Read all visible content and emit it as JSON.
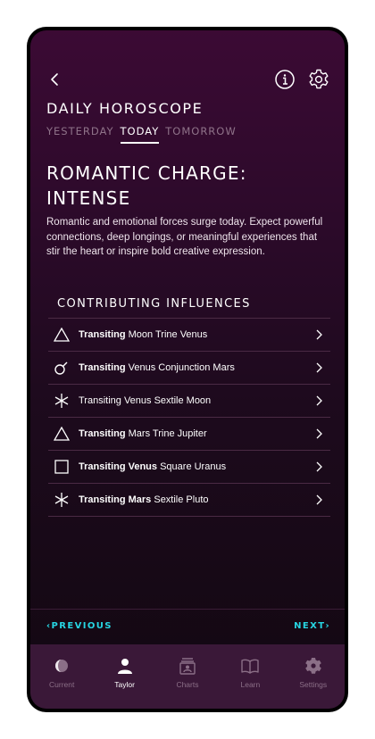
{
  "header": {
    "title": "DAILY HOROSCOPE"
  },
  "tabs": [
    {
      "label": "YESTERDAY"
    },
    {
      "label": "TODAY"
    },
    {
      "label": "TOMORROW"
    }
  ],
  "headline": "ROMANTIC CHARGE: INTENSE",
  "description": "Romantic and emotional forces surge today. Expect powerful connections, deep longings, or meaningful experiences that stir the heart or inspire bold creative expression.",
  "section_title": "CONTRIBUTING INFLUENCES",
  "influences": [
    {
      "bold": "Transiting",
      "text": " Moon Trine Venus",
      "icon": "trine-icon"
    },
    {
      "bold": "Transiting",
      "text": " Venus Conjunction Mars",
      "icon": "conjunction-icon"
    },
    {
      "bold": "",
      "text": "Transiting Venus Sextile Moon",
      "icon": "sextile-icon"
    },
    {
      "bold": "Transiting",
      "text": " Mars Trine Jupiter",
      "icon": "trine-icon"
    },
    {
      "bold": "Transiting Venus",
      "text": " Square Uranus",
      "icon": "square-icon"
    },
    {
      "bold": "Transiting Mars",
      "text": " Sextile Pluto",
      "icon": "sextile-icon"
    }
  ],
  "pager": {
    "prev": "PREVIOUS",
    "next": "NEXT"
  },
  "nav": [
    {
      "label": "Current",
      "icon": "moon-phase-icon"
    },
    {
      "label": "Taylor",
      "icon": "person-icon"
    },
    {
      "label": "Charts",
      "icon": "charts-icon"
    },
    {
      "label": "Learn",
      "icon": "book-icon"
    },
    {
      "label": "Settings",
      "icon": "gear-icon"
    }
  ],
  "colors": {
    "accent": "#27d5e2",
    "background_top": "#3b0a34",
    "background_bottom": "#120811",
    "nav_bg": "#3a1838"
  }
}
